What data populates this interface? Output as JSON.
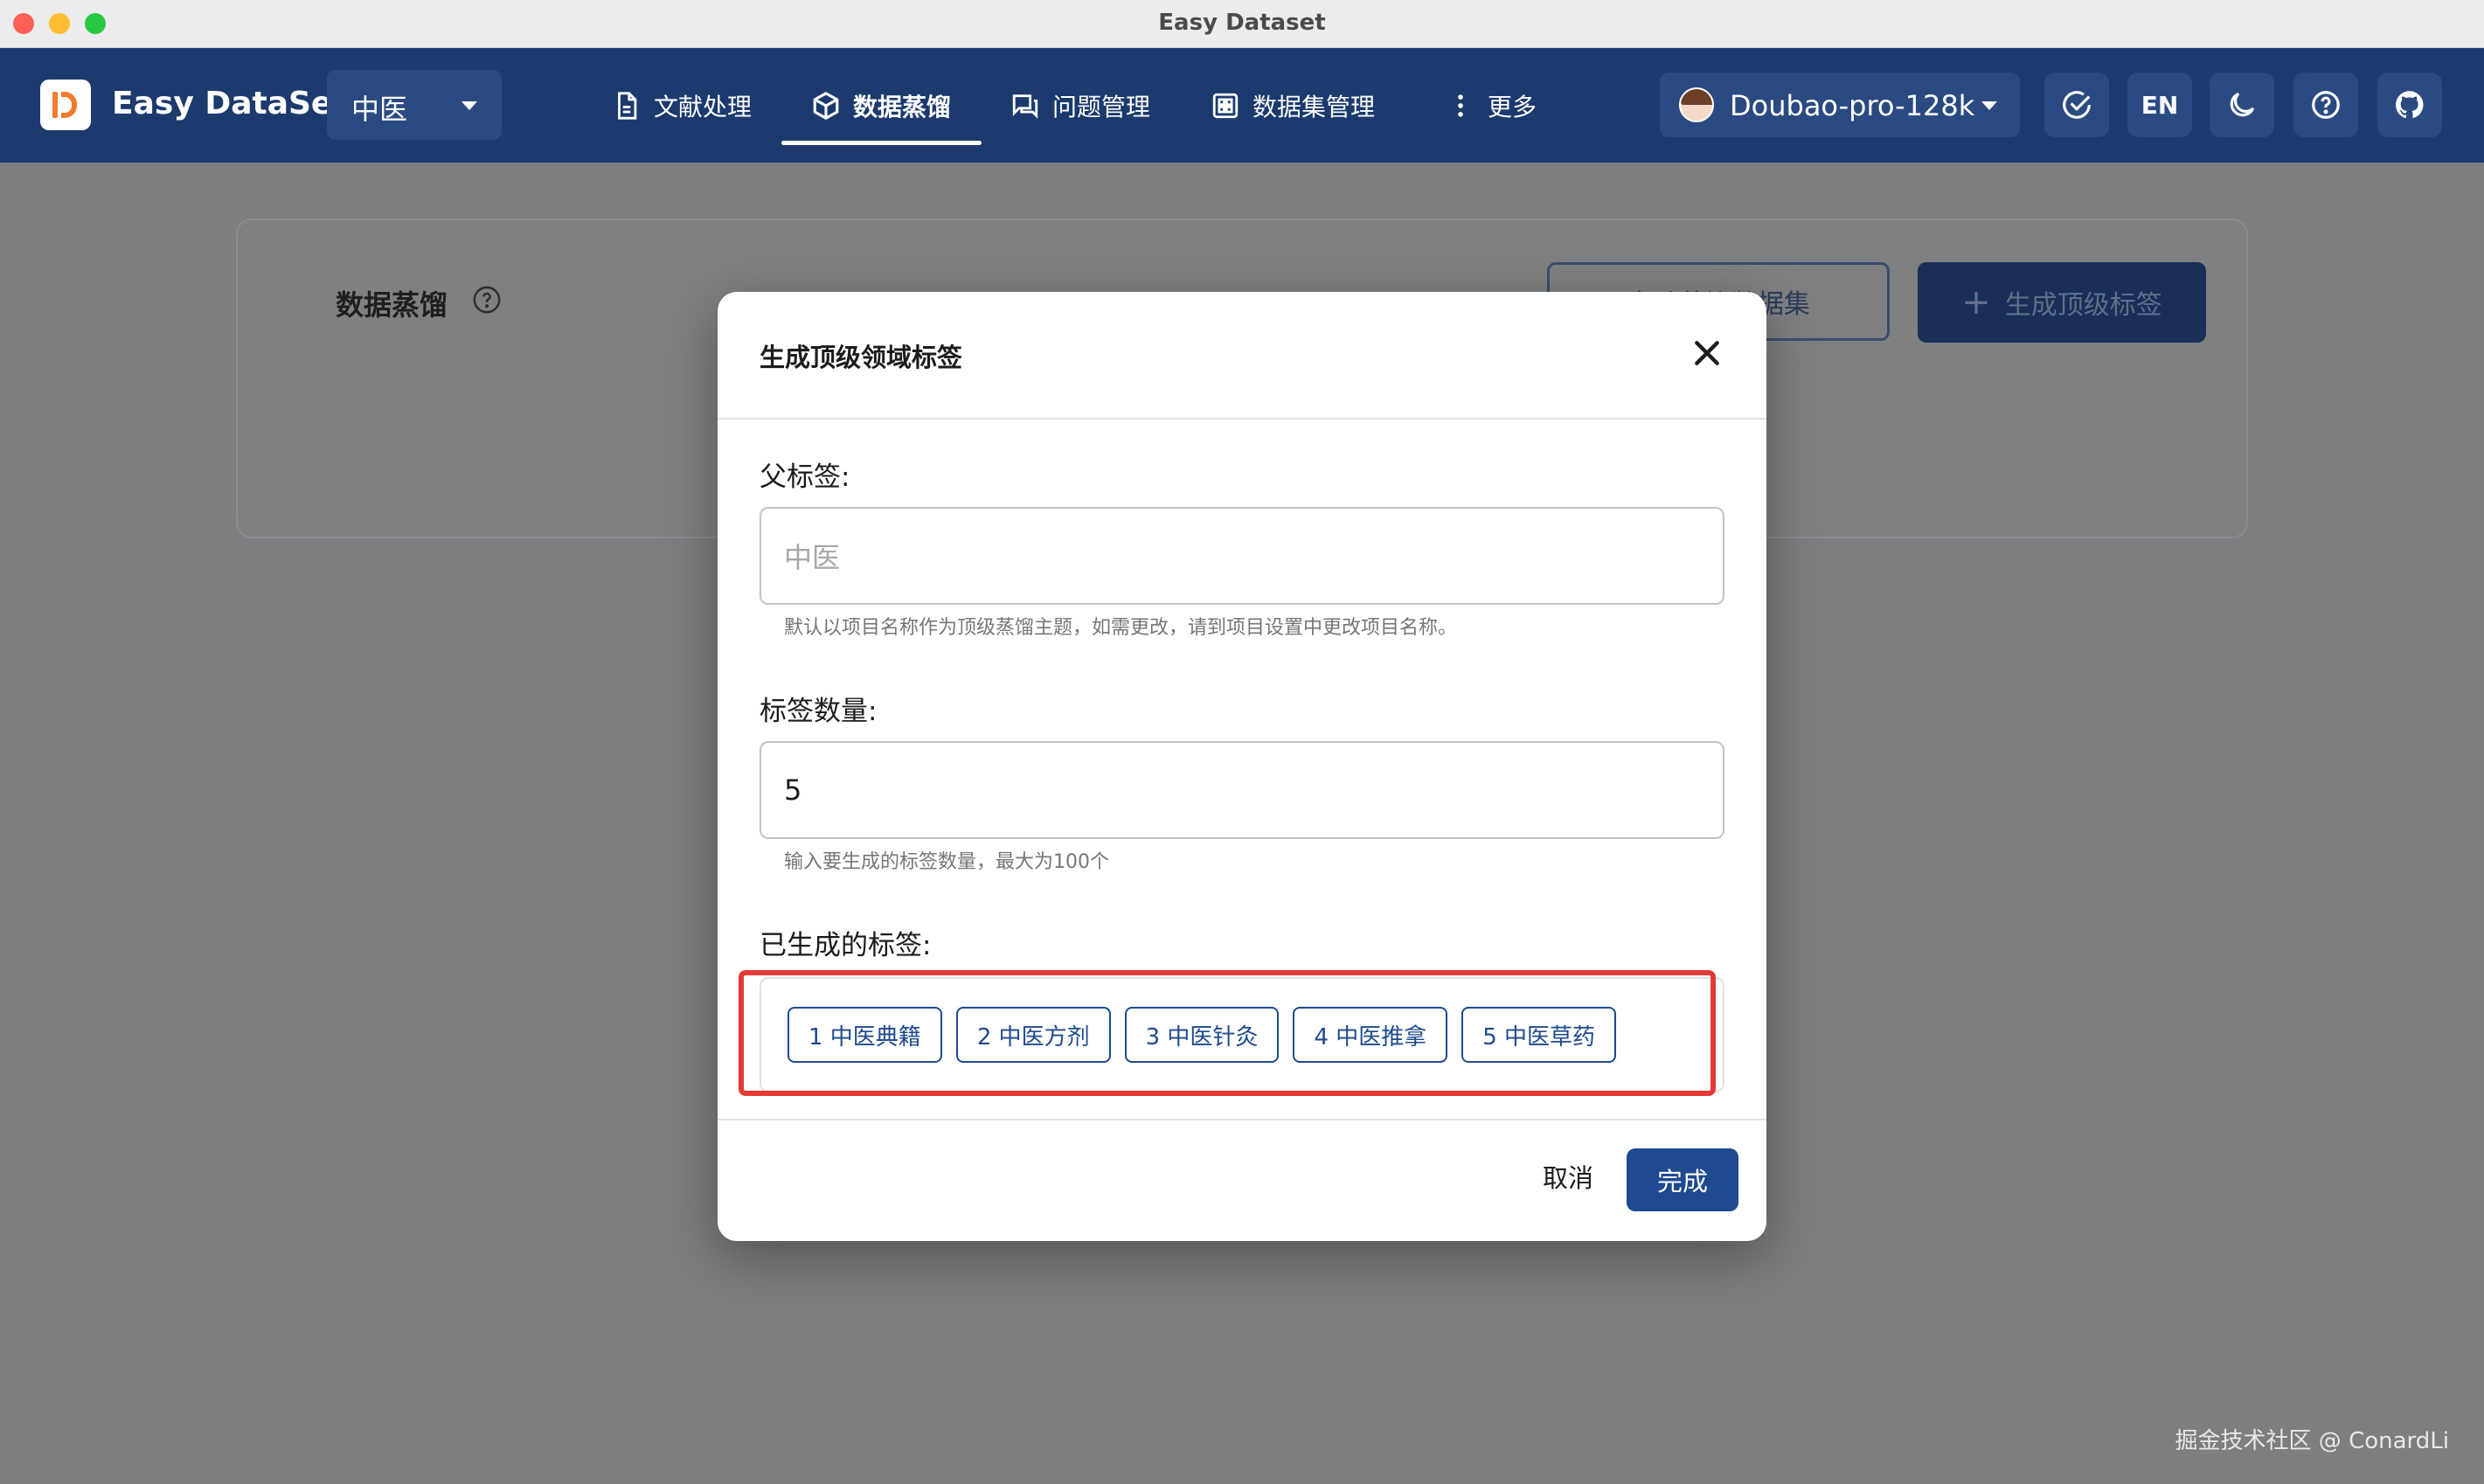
{
  "window": {
    "title": "Easy Dataset"
  },
  "header": {
    "brand": "Easy DataSet",
    "project_select": "中医",
    "nav": [
      {
        "label": "文献处理",
        "icon": "document-icon"
      },
      {
        "label": "数据蒸馏",
        "icon": "cube-icon",
        "active": true
      },
      {
        "label": "问题管理",
        "icon": "chat-icon"
      },
      {
        "label": "数据集管理",
        "icon": "grid-icon"
      },
      {
        "label": "更多",
        "icon": "more-vertical-icon"
      }
    ],
    "model_select": "Doubao-pro-128k",
    "lang_button": "EN",
    "icons": [
      "check-circle-icon",
      "moon-icon",
      "help-circle-icon",
      "github-icon"
    ]
  },
  "page": {
    "title": "数据蒸馏",
    "outline_button": "自动蒸馏数据集",
    "primary_button": "生成顶级标签"
  },
  "dialog": {
    "title": "生成顶级领域标签",
    "parent_label": "父标签:",
    "parent_value": "中医",
    "parent_helper": "默认以项目名称作为顶级蒸馏主题，如需更改，请到项目设置中更改项目名称。",
    "count_label": "标签数量:",
    "count_value": "5",
    "count_helper": "输入要生成的标签数量，最大为100个",
    "generated_label": "已生成的标签:",
    "tags": [
      "1 中医典籍",
      "2 中医方剂",
      "3 中医针灸",
      "4 中医推拿",
      "5 中医草药"
    ],
    "cancel": "取消",
    "done": "完成"
  },
  "colors": {
    "header": "#1d3a6e",
    "primary": "#1e4a8f",
    "highlight": "#e53935"
  },
  "watermark": "掘金技术社区 @ ConardLi"
}
